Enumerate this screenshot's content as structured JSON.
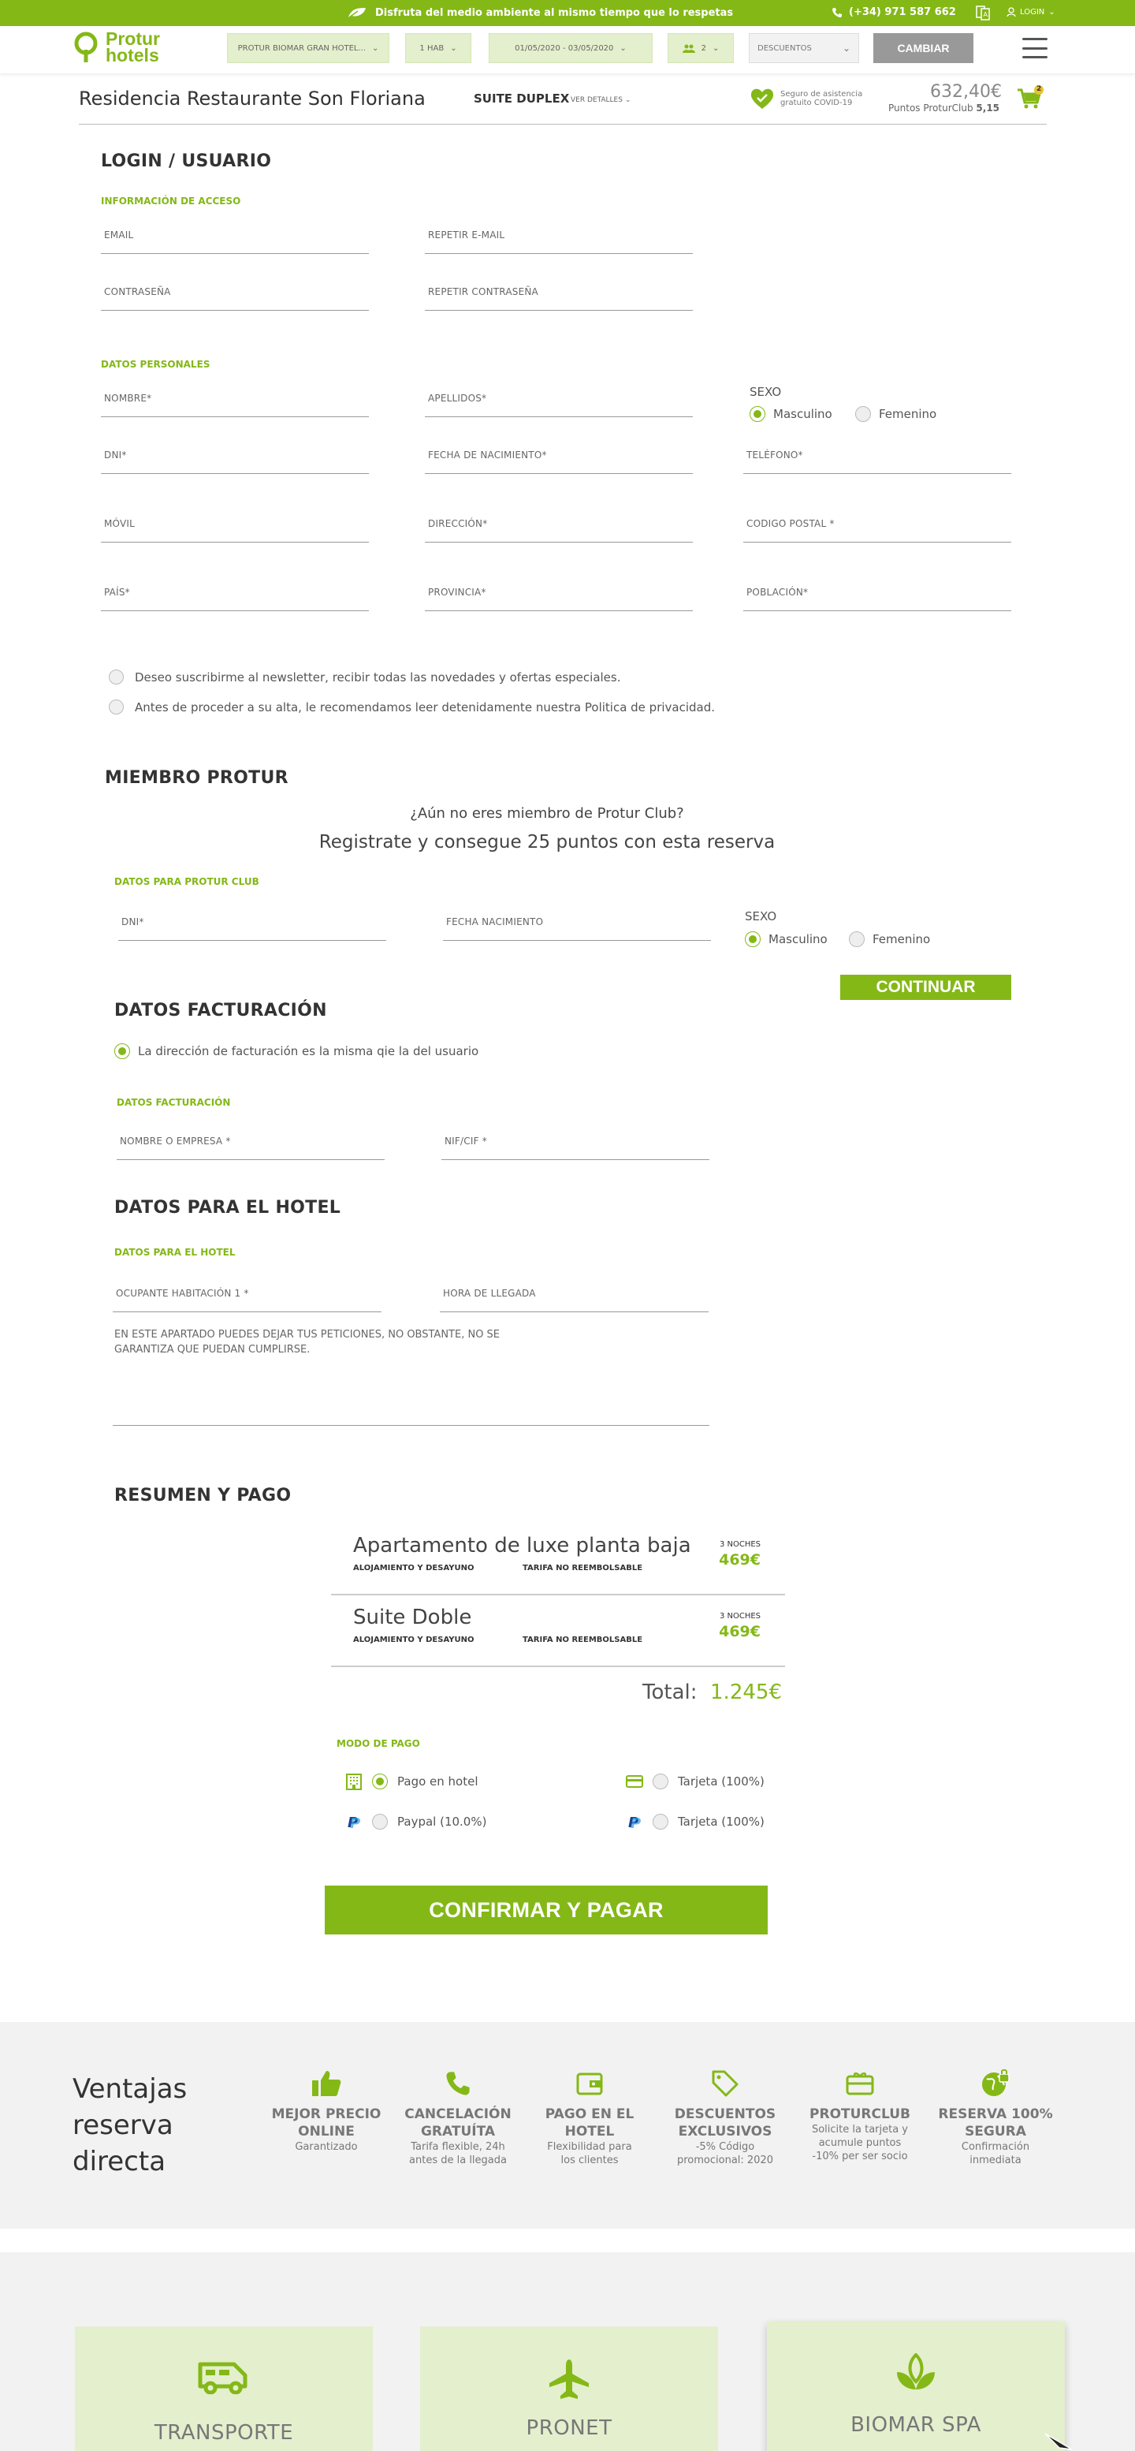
{
  "topbar": {
    "message": "Disfruta del medio ambiente al mismo tiempo que lo respetas",
    "phone": "(+34) 971 587 662",
    "login": "LOGIN"
  },
  "nav": {
    "logo_line1": "Protur",
    "logo_line2": "hotels",
    "hotel_select": "PROTUR BIOMAR GRAN HOTEL...",
    "rooms_select": "1 HAB",
    "dates": "01/05/2020 - 03/05/2020",
    "guests": "2",
    "discount_placeholder": "DESCUENTOS",
    "change_button": "CAMBIAR"
  },
  "booking_header": {
    "hotel_name": "Residencia Restaurante Son Floriana",
    "room_type": "SUITE DUPLEX",
    "details_link": "VER DETALLES",
    "covid_line1": "Seguro de asistencia",
    "covid_line2": "gratuito COVID-19",
    "price": "632,40€",
    "points_label": "Puntos ProturClub",
    "points_value": "5,15",
    "cart_count": "2"
  },
  "login_section": {
    "title": "LOGIN / USUARIO",
    "access_subtitle": "INFORMACIÓN DE ACCESO",
    "email": "EMAIL",
    "repeat_email": "REPETIR E-MAIL",
    "password": "CONTRASEÑA",
    "repeat_password": "REPETIR CONTRASEÑA",
    "personal_subtitle": "DATOS PERSONALES",
    "nombre": "NOMBRE*",
    "apellidos": "APELLIDOS*",
    "sexo": "SEXO",
    "masculino": "Masculino",
    "femenino": "Femenino",
    "dni": "DNI*",
    "fecha_nacimiento": "FECHA DE NACIMIENTO*",
    "telefono": "TELÉFONO*",
    "movil": "MÓVIL",
    "direccion": "DIRECCIÓN*",
    "codigo_postal": "CODIGO POSTAL *",
    "pais": "PAÍS*",
    "provincia": "PROVINCIA*",
    "poblacion": "POBLACIÓN*",
    "newsletter": "Deseo suscribirme al newsletter, recibir todas las novedades y ofertas especiales.",
    "privacy": "Antes de proceder a su alta, le recomendamos leer detenidamente nuestra Politica de privacidad."
  },
  "member_section": {
    "title": "MIEMBRO PROTUR",
    "question": "¿Aún no eres miembro de Protur Club?",
    "promo": "Registrate y consegue 25 puntos con esta reserva",
    "subtitle": "DATOS PARA PROTUR CLUB",
    "dni": "DNI*",
    "fecha_nacimiento": "FECHA NACIMIENTO",
    "sexo": "SEXO",
    "masculino": "Masculino",
    "femenino": "Femenino",
    "continue_button": "CONTINUAR"
  },
  "billing_section": {
    "title": "DATOS FACTURACIÓN",
    "same_address": "La dirección de facturación es la misma qie la del usuario",
    "subtitle": "DATOS FACTURACIÓN",
    "company": "NOMBRE O EMPRESA *",
    "nif": "NIF/CIF *"
  },
  "hotel_section": {
    "title": "DATOS PARA EL HOTEL",
    "subtitle": "DATOS PARA EL HOTEL",
    "occupant": "OCUPANTE HABITACIÓN 1 *",
    "arrival": "HORA DE LLEGADA",
    "requests_line1": "EN ESTE APARTADO PUEDES DEJAR TUS PETICIONES, NO OBSTANTE, NO SE",
    "requests_line2": "GARANTIZA QUE PUEDAN CUMPLIRSE."
  },
  "summary_section": {
    "title": "RESUMEN Y PAGO",
    "rooms": [
      {
        "name": "Apartamento de luxe planta baja",
        "board": "ALOJAMIENTO Y DESAYUNO",
        "rate": "TARIFA NO REEMBOLSABLE",
        "nights": "3 NOCHES",
        "price": "469€"
      },
      {
        "name": "Suite Doble",
        "board": "ALOJAMIENTO Y DESAYUNO",
        "rate": "TARIFA NO REEMBOLSABLE",
        "nights": "3 NOCHES",
        "price": "469€"
      }
    ],
    "total_label": "Total:",
    "total_value": "1.245€",
    "payment_subtitle": "MODO DE PAGO",
    "pay_hotel": "Pago en hotel",
    "pay_card_1": "Tarjeta (100%)",
    "pay_paypal": "Paypal (10.0%)",
    "pay_card_2": "Tarjeta (100%)",
    "confirm_button": "CONFIRMAR Y PAGAR"
  },
  "advantages": {
    "title_line1": "Ventajas",
    "title_line2": "reserva",
    "title_line3": "directa",
    "items": [
      {
        "title1": "MEJOR PRECIO",
        "title2": "ONLINE",
        "desc1": "Garantizado",
        "desc2": "",
        "icon": "thumbs-up-icon"
      },
      {
        "title1": "CANCELACIÓN",
        "title2": "GRATUÍTA",
        "desc1": "Tarifa flexible, 24h",
        "desc2": "antes de la llegada",
        "icon": "phone-icon"
      },
      {
        "title1": "PAGO EN EL",
        "title2": "HOTEL",
        "desc1": "Flexibilidad para",
        "desc2": "los clientes",
        "icon": "wallet-icon"
      },
      {
        "title1": "DESCUENTOS",
        "title2": "EXCLUSIVOS",
        "desc1": "-5% Código",
        "desc2": "promocional: 2020",
        "icon": "tag-icon"
      },
      {
        "title1": "PROTURCLUB",
        "title2": "",
        "desc1": "Solicite la tarjeta y",
        "desc2": "acumule puntos",
        "desc3": "-10% per ser socio",
        "icon": "gift-card-icon"
      },
      {
        "title1": "RESERVA 100%",
        "title2": "SEGURA",
        "desc1": "Confirmación",
        "desc2": "inmediata",
        "icon": "secure-globe-icon"
      }
    ]
  },
  "extras": {
    "cards": [
      {
        "label": "TRANSPORTE",
        "icon": "van-icon"
      },
      {
        "label": "PRONET",
        "icon": "plane-icon"
      },
      {
        "label": "BIOMAR SPA",
        "icon": "leaf-icon"
      }
    ]
  },
  "colors": {
    "brand_green": "#84b817",
    "light_green": "#e4efcd",
    "button_grey": "#999999"
  }
}
